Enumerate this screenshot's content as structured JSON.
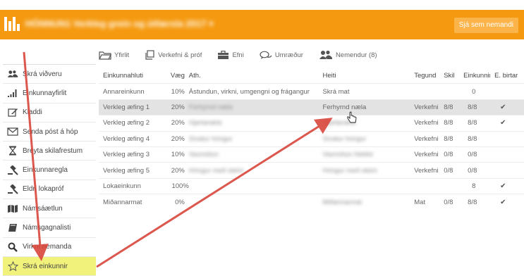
{
  "header": {
    "course_title": "HÓNNUN1 Verkleg grein og útfærsla 2017 ▾",
    "see_as_student": "Sjá sem nemandi"
  },
  "tabs": [
    {
      "label": "Yfirlit",
      "icon": "folder-icon"
    },
    {
      "label": "Verkefni & próf",
      "icon": "copy-icon"
    },
    {
      "label": "Efni",
      "icon": "briefcase-icon"
    },
    {
      "label": "Umræður",
      "icon": "chat-icon"
    },
    {
      "label": "Nemendur (8)",
      "icon": "users-icon"
    }
  ],
  "sidebar": {
    "items": [
      {
        "label": "Skrá viðveru",
        "icon": "users-icon"
      },
      {
        "label": "Einkunnayfirlit",
        "icon": "bar-chart-icon"
      },
      {
        "label": "Kladdi",
        "icon": "edit-icon"
      },
      {
        "label": "Senda póst á hóp",
        "icon": "envelope-icon"
      },
      {
        "label": "Breyta skilafrestum",
        "icon": "hourglass-icon"
      },
      {
        "label": "Einkunnaregla",
        "icon": "gavel-icon"
      },
      {
        "label": "Eldri lokapróf",
        "icon": "gavel-icon"
      },
      {
        "label": "Námsáætlun",
        "icon": "map-icon"
      },
      {
        "label": "Námsgagnalisti",
        "icon": "book-icon"
      },
      {
        "label": "Virkni nemanda",
        "icon": "search-icon"
      },
      {
        "label": "Skrá einkunnir",
        "icon": "star-icon"
      }
    ]
  },
  "grades_table": {
    "headers": [
      "Einkunnahluti",
      "Vægi",
      "Ath.",
      "Heiti",
      "Tegund",
      "Skil",
      "Einkunnir",
      "E. birtar"
    ],
    "rows": [
      {
        "part": "Annareinkunn",
        "weight": "10%",
        "note": "Ástundun, virkni, umgengni og frágangur",
        "name": "Skrá mat",
        "type": "",
        "submitted": "",
        "grades": "0",
        "published": ""
      },
      {
        "part": "Verkleg æfing 1",
        "weight": "20%",
        "note": "Ferhyrnd næla",
        "name": "Ferhyrnd næla",
        "type": "Verkefni",
        "submitted": "8/8",
        "grades": "8/8",
        "published": "✔"
      },
      {
        "part": "Verkleg æfing 2",
        "weight": "20%",
        "note": "Hjartanæla",
        "name": "Hjartanæla",
        "type": "Verkefni",
        "submitted": "8/8",
        "grades": "8/8",
        "published": "✔"
      },
      {
        "part": "Verkleg æfing 4",
        "weight": "20%",
        "note": "Sívalur hringur",
        "name": "Sívalur hringur",
        "type": "Verkefni",
        "submitted": "8/8",
        "grades": "8/8",
        "published": ""
      },
      {
        "part": "Verkleg æfing 3",
        "weight": "10%",
        "note": "Vaxmótun",
        "name": "Vaxmótun hlekkir",
        "type": "Verkefni",
        "submitted": "0/8",
        "grades": "0/8",
        "published": ""
      },
      {
        "part": "Verkleg æfing 5",
        "weight": "20%",
        "note": "Hringur með steini",
        "name": "Hringur með steini",
        "type": "Verkefni",
        "submitted": "0/8",
        "grades": "0/8",
        "published": ""
      },
      {
        "part": "Lokaeinkunn",
        "weight": "100%",
        "note": "",
        "name": "",
        "type": "",
        "submitted": "",
        "grades": "8",
        "published": "✔"
      },
      {
        "part": "Miðannarmat",
        "weight": "0%",
        "note": "",
        "name": "Miðannarmat",
        "type": "Mat",
        "submitted": "0/8",
        "grades": "8/8",
        "published": "✔"
      }
    ]
  },
  "colors": {
    "topbar": "#f59a10",
    "active_sidebar": "#f1f27c",
    "annotation_arrow": "#d9453a",
    "row_highlight": "#e3e3e3"
  }
}
